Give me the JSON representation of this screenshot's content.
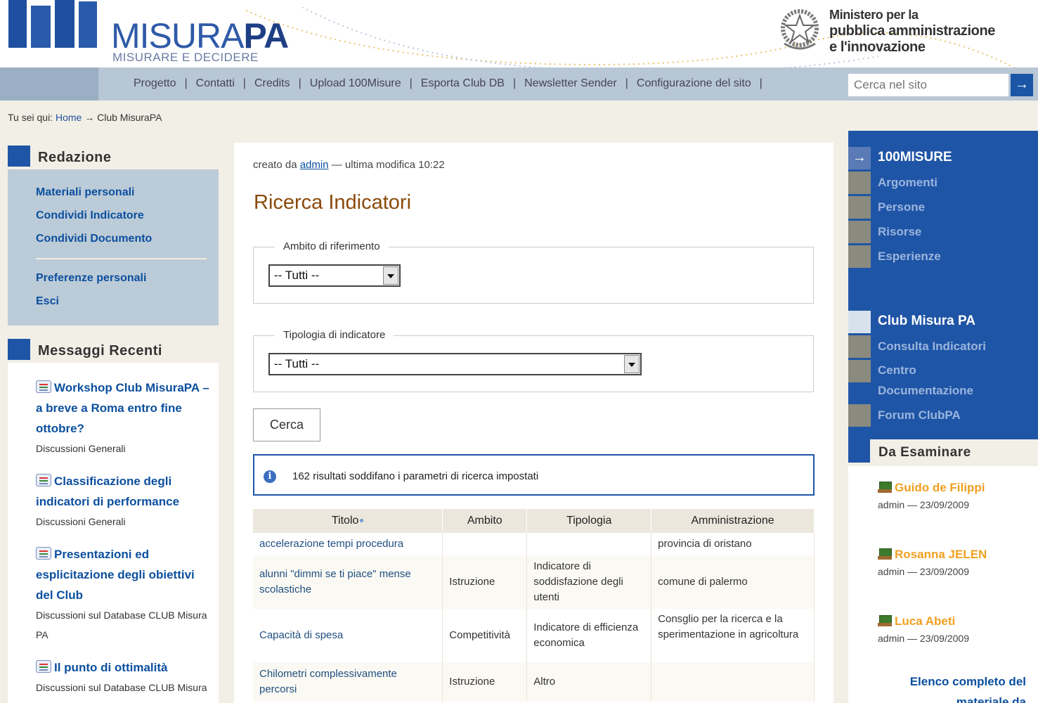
{
  "header": {
    "logo_main": "MISURA",
    "logo_bold": "PA",
    "logo_sub": "MISURARE E DECIDERE",
    "ministry_line1": "Ministero per la",
    "ministry_line2": "pubblica amministrazione",
    "ministry_line3": "e l'innovazione"
  },
  "nav": {
    "items": [
      "Progetto",
      "Contatti",
      "Credits",
      "Upload 100Misure",
      "Esporta Club DB",
      "Newsletter Sender",
      "Configurazione del sito"
    ],
    "search_placeholder": "Cerca nel sito",
    "search_button": "→"
  },
  "breadcrumb": {
    "prefix": "Tu sei qui:",
    "home": "Home",
    "arrow": "→",
    "current": "Club MisuraPA"
  },
  "redazione": {
    "title": "Redazione",
    "items": [
      "Materiali personali",
      "Condividi Indicatore",
      "Condividi Documento",
      "Preferenze personali",
      "Esci"
    ]
  },
  "messages": {
    "title": "Messaggi Recenti",
    "items": [
      {
        "title": "Workshop Club MisuraPA – a breve a Roma entro fine ottobre?",
        "category": "Discussioni Generali"
      },
      {
        "title": "Classificazione degli indicatori di performance",
        "category": "Discussioni Generali"
      },
      {
        "title": "Presentazioni ed esplicitazione degli obiettivi del Club",
        "category": "Discussioni sul Database CLUB Misura PA"
      },
      {
        "title": "Il punto di ottimalità",
        "category": "Discussioni sul Database CLUB Misura PA"
      }
    ]
  },
  "main": {
    "byline_prefix": "creato da",
    "byline_author": "admin",
    "byline_suffix": "— ultima modifica 10:22",
    "title": "Ricerca Indicatori",
    "fieldset1_legend": "Ambito di riferimento",
    "fieldset1_value": "-- Tutti --",
    "fieldset2_legend": "Tipologia di indicatore",
    "fieldset2_value": "-- Tutti --",
    "search_button": "Cerca",
    "info_text": "162 risultati soddifano i parametri di ricerca impostati"
  },
  "table": {
    "headers": [
      "Titolo",
      "Ambito",
      "Tipologia",
      "Amministrazione"
    ],
    "rows": [
      [
        "accelerazione tempi procedura",
        "",
        "",
        "provincia di oristano"
      ],
      [
        "alunni \"dimmi se ti piace\" mense scolastiche",
        "Istruzione",
        "Indicatore di soddisfazione degli utenti",
        "comune di palermo"
      ],
      [
        "Capacità di spesa",
        "Competitività",
        "Indicatore di efficienza economica",
        "Consglio per la ricerca e la sperimentazione in agricoltura"
      ],
      [
        "Chilometri complessivamente percorsi",
        "Istruzione",
        "Altro",
        ""
      ]
    ]
  },
  "right": {
    "section1_title": "100MISURE",
    "section1_items": [
      "Argomenti",
      "Persone",
      "Risorse",
      "Esperienze"
    ],
    "section2_title": "Club Misura PA",
    "section2_items": [
      "Consulta Indicatori",
      "Centro",
      "Documentazione",
      "Forum ClubPA"
    ],
    "review_title": "Da Esaminare",
    "review_items": [
      {
        "name": "Guido de Filippi",
        "meta": "admin — 23/09/2009"
      },
      {
        "name": "Rosanna JELEN",
        "meta": "admin — 23/09/2009"
      },
      {
        "name": "Luca Abeti",
        "meta": "admin — 23/09/2009"
      }
    ],
    "full_list_line1": "Elenco completo del",
    "full_list_line2": "materiale da"
  },
  "colors": {
    "brand_blue": "#1f55a6",
    "title_brown": "#8a4a09",
    "person_orange": "#f0a020"
  }
}
